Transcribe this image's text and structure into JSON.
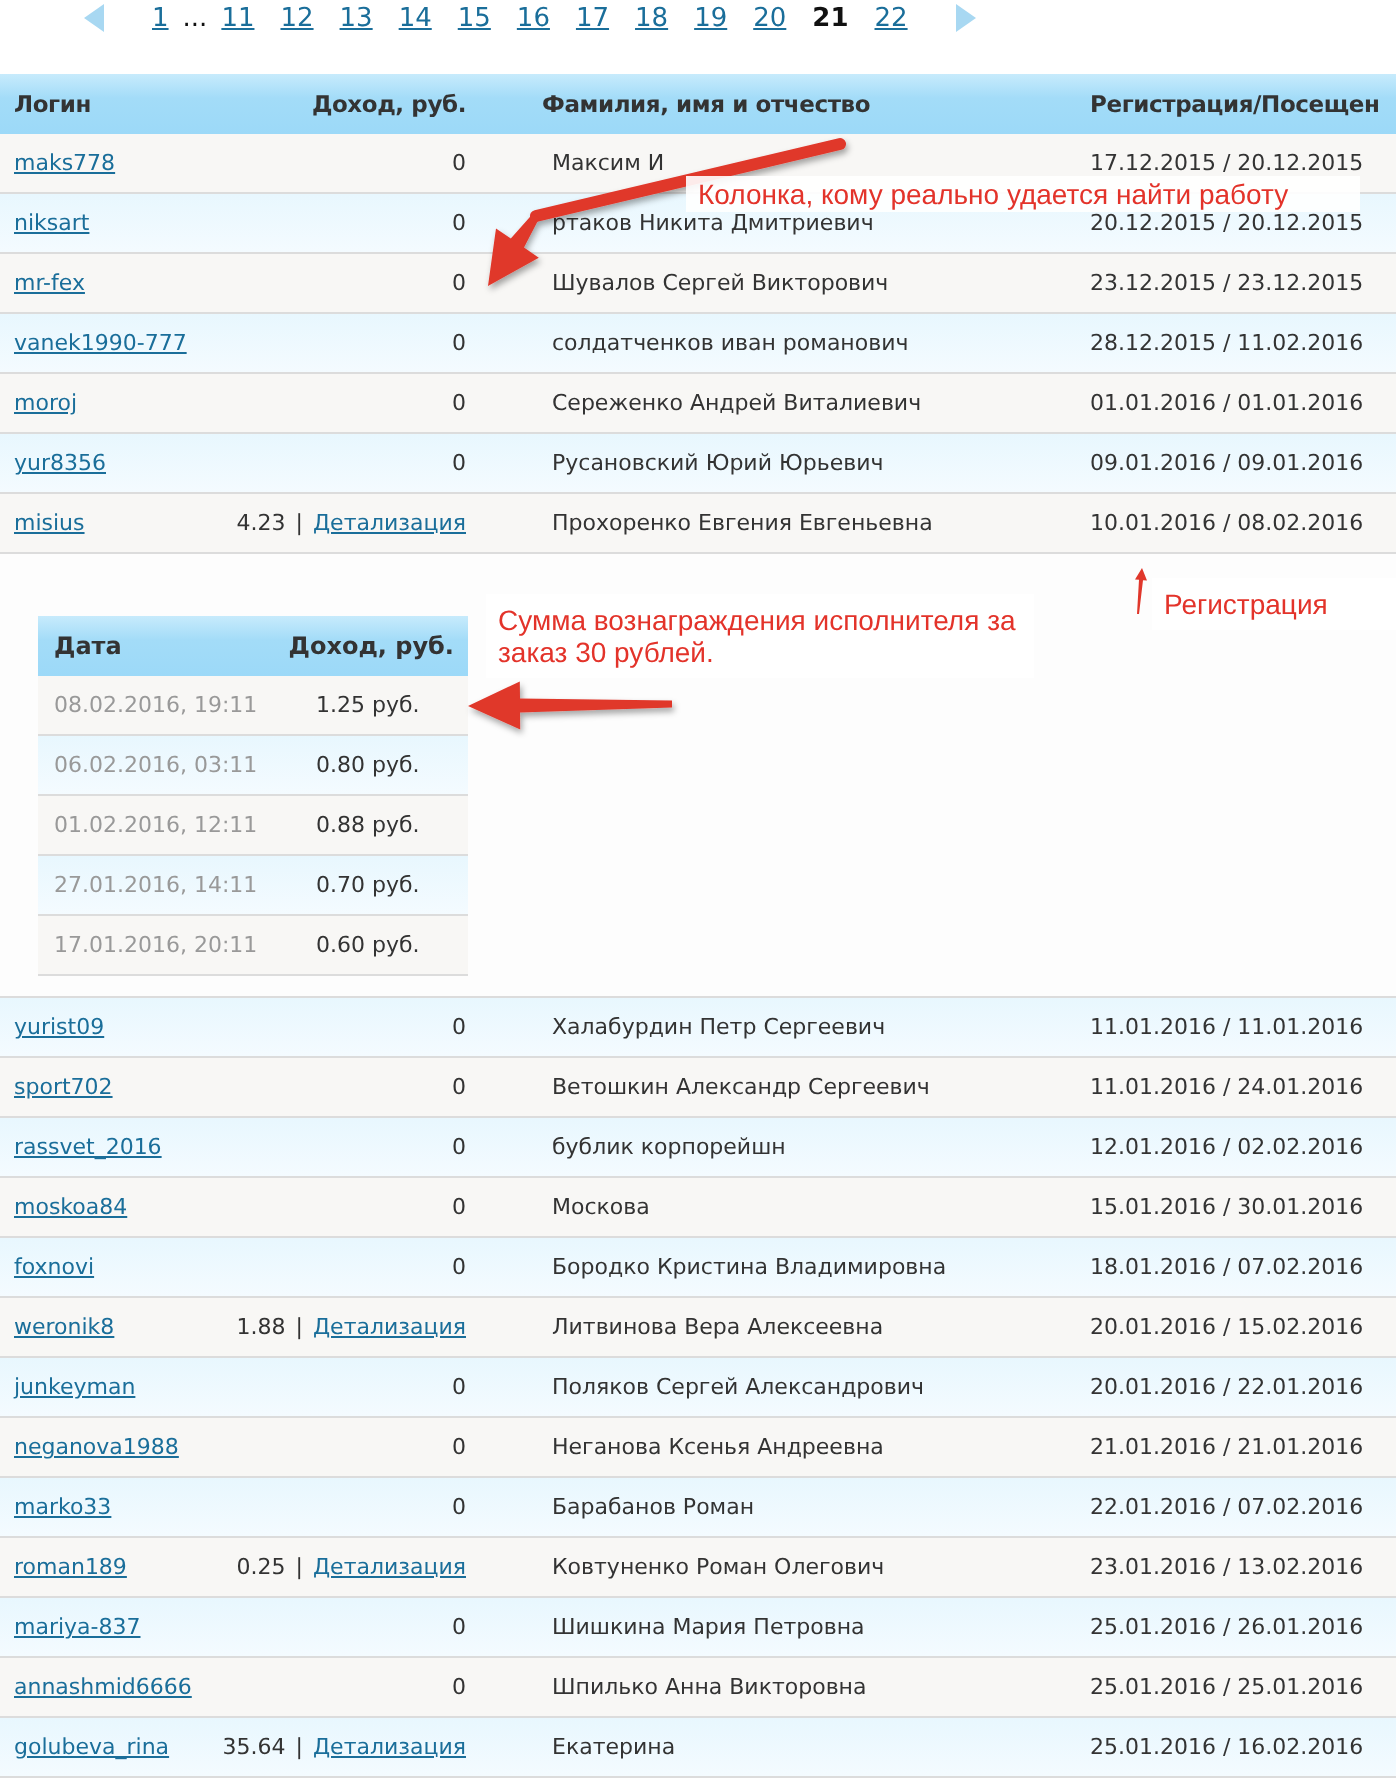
{
  "pagination": {
    "pages": [
      {
        "kind": "page",
        "label": "1",
        "selected": false
      },
      {
        "kind": "gap",
        "label": "..."
      },
      {
        "kind": "page",
        "label": "11",
        "selected": false
      },
      {
        "kind": "page",
        "label": "12",
        "selected": false
      },
      {
        "kind": "page",
        "label": "13",
        "selected": false
      },
      {
        "kind": "page",
        "label": "14",
        "selected": false
      },
      {
        "kind": "page",
        "label": "15",
        "selected": false
      },
      {
        "kind": "page",
        "label": "16",
        "selected": false
      },
      {
        "kind": "page",
        "label": "17",
        "selected": false
      },
      {
        "kind": "page",
        "label": "18",
        "selected": false
      },
      {
        "kind": "page",
        "label": "19",
        "selected": false
      },
      {
        "kind": "page",
        "label": "20",
        "selected": false
      },
      {
        "kind": "page",
        "label": "21",
        "selected": true
      },
      {
        "kind": "page",
        "label": "22",
        "selected": false
      }
    ]
  },
  "table": {
    "columns": [
      "Логин",
      "Доход, руб.",
      "Фамилия, имя и отчество",
      "Регистрация/Посещен"
    ],
    "rows": [
      {
        "login": "maks778",
        "income": "0",
        "name": "Максим И",
        "dates": "17.12.2015 / 20.12.2015"
      },
      {
        "login": "niksart",
        "income": "0",
        "name": "ртаков Никита Дмитриевич",
        "dates": "20.12.2015 / 20.12.2015"
      },
      {
        "login": "mr-fex",
        "income": "0",
        "name": "Шувалов Сергей Викторович",
        "dates": "23.12.2015 / 23.12.2015"
      },
      {
        "login": "vanek1990-777",
        "income": "0",
        "name": "солдатченков иван романович",
        "dates": "28.12.2015 / 11.02.2016"
      },
      {
        "login": "moroj",
        "income": "0",
        "name": "Сереженко Андрей Виталиевич",
        "dates": "01.01.2016 / 01.01.2016"
      },
      {
        "login": "yur8356",
        "income": "0",
        "name": "Русановский Юрий Юрьевич",
        "dates": "09.01.2016 / 09.01.2016"
      },
      {
        "login": "misius",
        "income": "4.23",
        "separator": "|",
        "detail_link": "Детализация",
        "name": "Прохоренко Евгения Евгеньевна",
        "dates": "10.01.2016 / 08.02.2016",
        "details": {
          "columns": [
            "Дата",
            "Доход, руб."
          ],
          "rows": [
            {
              "date": "08.02.2016, 19:11",
              "amount": "1.25 руб."
            },
            {
              "date": "06.02.2016, 03:11",
              "amount": "0.80 руб."
            },
            {
              "date": "01.02.2016, 12:11",
              "amount": "0.88 руб."
            },
            {
              "date": "27.01.2016, 14:11",
              "amount": "0.70 руб."
            },
            {
              "date": "17.01.2016, 20:11",
              "amount": "0.60 руб."
            }
          ]
        }
      },
      {
        "login": "yurist09",
        "income": "0",
        "name": "Халабурдин Петр Сергеевич",
        "dates": "11.01.2016 / 11.01.2016"
      },
      {
        "login": "sport702",
        "income": "0",
        "name": "Ветошкин Александр Сергеевич",
        "dates": "11.01.2016 / 24.01.2016"
      },
      {
        "login": "rassvet_2016",
        "income": "0",
        "name": "бублик корпорейшн",
        "dates": "12.01.2016 / 02.02.2016"
      },
      {
        "login": "moskoa84",
        "income": "0",
        "name": "Москова",
        "dates": "15.01.2016 / 30.01.2016"
      },
      {
        "login": "foxnovi",
        "income": "0",
        "name": "Бородко Кристина Владимировна",
        "dates": "18.01.2016 / 07.02.2016"
      },
      {
        "login": "weronik8",
        "income": "1.88",
        "separator": "|",
        "detail_link": "Детализация",
        "name": "Литвинова Вера Алексеевна",
        "dates": "20.01.2016 / 15.02.2016"
      },
      {
        "login": "junkeyman",
        "income": "0",
        "name": "Поляков Сергей Александрович",
        "dates": "20.01.2016 / 22.01.2016"
      },
      {
        "login": "neganova1988",
        "income": "0",
        "name": "Неганова Ксенья Андреевна",
        "dates": "21.01.2016 / 21.01.2016"
      },
      {
        "login": "marko33",
        "income": "0",
        "name": "Барабанов Роман",
        "dates": "22.01.2016 / 07.02.2016"
      },
      {
        "login": "roman189",
        "income": "0.25",
        "separator": "|",
        "detail_link": "Детализация",
        "name": "Ковтуненко Роман Олегович",
        "dates": "23.01.2016 / 13.02.2016"
      },
      {
        "login": "mariya-837",
        "income": "0",
        "name": "Шишкина Мария Петровна",
        "dates": "25.01.2016 / 26.01.2016"
      },
      {
        "login": "annashmid6666",
        "income": "0",
        "name": "Шпилько Анна Викторовна",
        "dates": "25.01.2016 / 25.01.2016"
      },
      {
        "login": "golubeva_rina",
        "income": "35.64",
        "separator": "|",
        "detail_link": "Детализация",
        "name": "Екатерина",
        "dates": "25.01.2016 / 16.02.2016"
      }
    ]
  },
  "annotations": [
    {
      "text": "Колонка, кому реально удается найти работу"
    },
    {
      "text": "Сумма вознаграждения исполнителя за заказ 30 рублей."
    },
    {
      "text": "Регистрация"
    }
  ]
}
